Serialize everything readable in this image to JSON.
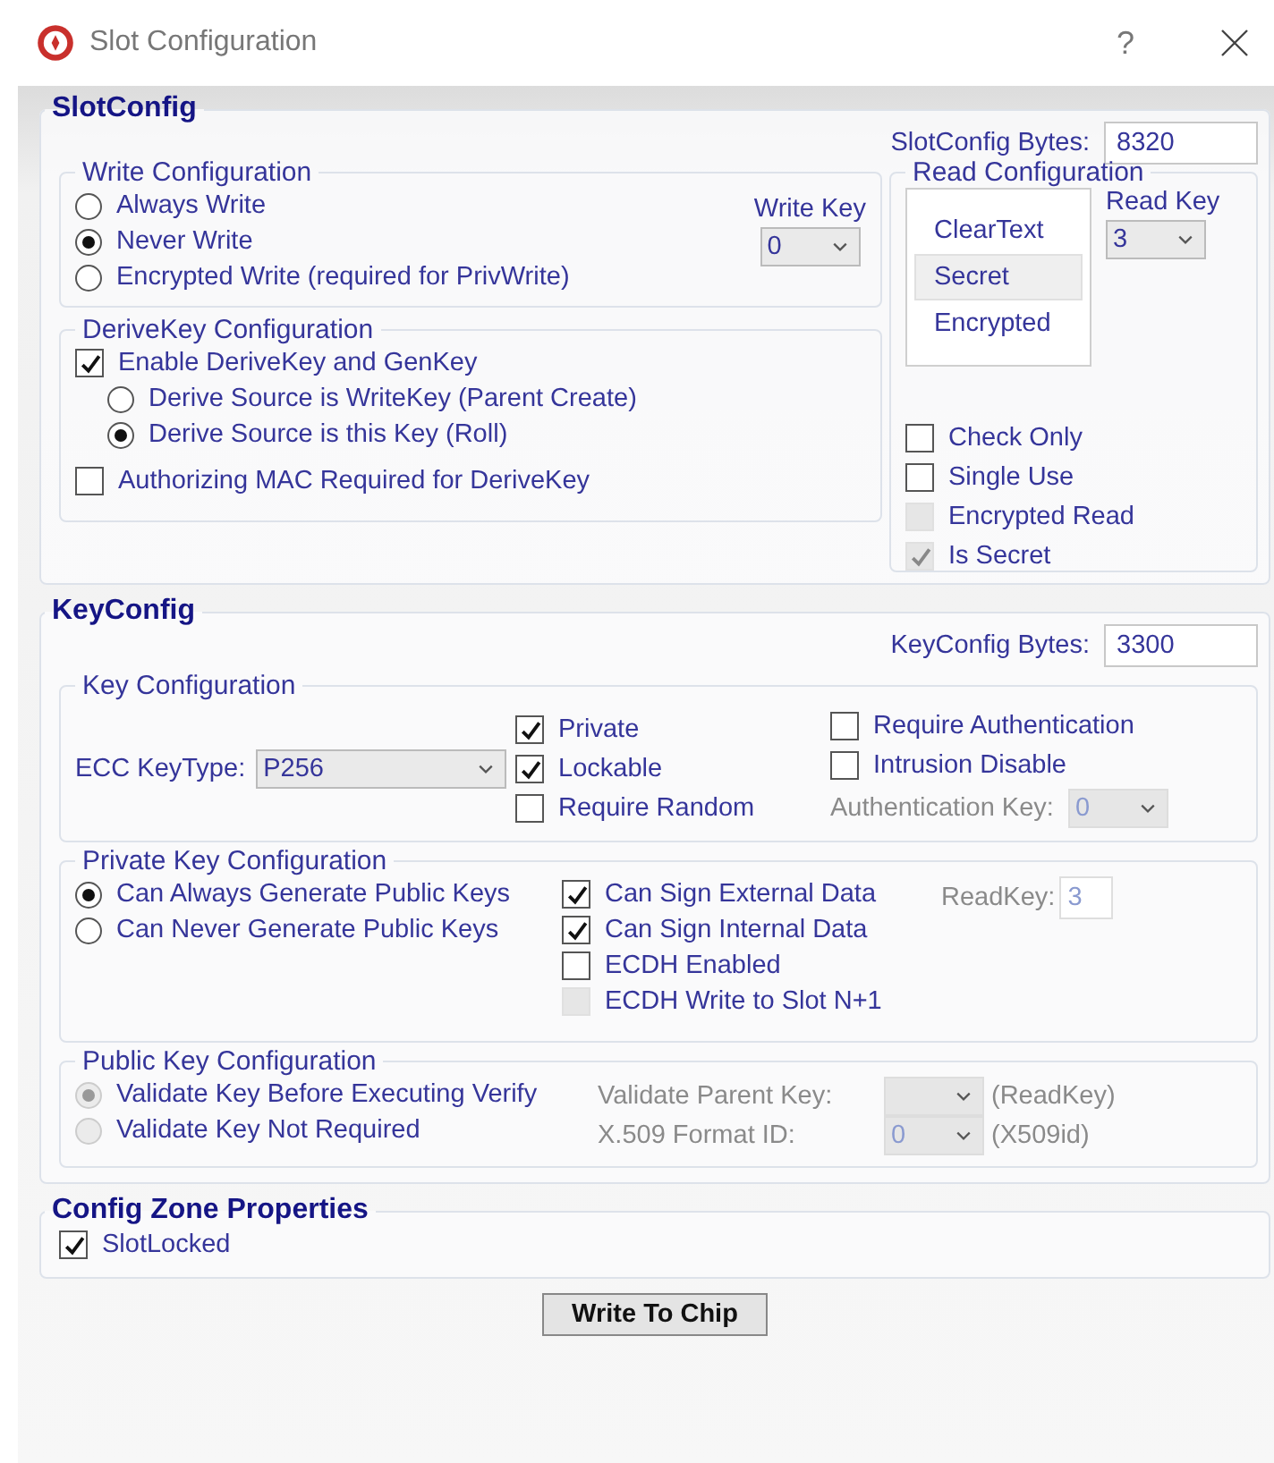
{
  "window": {
    "title": "Slot Configuration",
    "help": "?"
  },
  "slot_config": {
    "title": "SlotConfig",
    "bytes_label": "SlotConfig Bytes:",
    "bytes_value": "8320",
    "write_configuration": {
      "title": "Write Configuration",
      "options": [
        {
          "label": "Always Write",
          "selected": false
        },
        {
          "label": "Never Write",
          "selected": true
        },
        {
          "label": "Encrypted Write (required for PrivWrite)",
          "selected": false
        }
      ],
      "write_key": {
        "label": "Write Key",
        "value": "0"
      }
    },
    "derivekey_configuration": {
      "title": "DeriveKey Configuration",
      "enable": {
        "label": "Enable DeriveKey and GenKey",
        "checked": true
      },
      "sources": [
        {
          "label": "Derive Source is WriteKey (Parent Create)",
          "selected": false
        },
        {
          "label": "Derive Source is this Key (Roll)",
          "selected": true
        }
      ],
      "authorizing_mac": {
        "label": "Authorizing MAC Required for DeriveKey",
        "checked": false
      }
    },
    "read_configuration": {
      "title": "Read Configuration",
      "modes": [
        {
          "label": "ClearText",
          "selected": false
        },
        {
          "label": "Secret",
          "selected": true
        },
        {
          "label": "Encrypted",
          "selected": false
        }
      ],
      "read_key": {
        "label": "Read Key",
        "value": "3"
      },
      "options": [
        {
          "label": "Check Only",
          "checked": false,
          "disabled": false
        },
        {
          "label": "Single Use",
          "checked": false,
          "disabled": false
        },
        {
          "label": "Encrypted Read",
          "checked": false,
          "disabled": true
        },
        {
          "label": "Is Secret",
          "checked": true,
          "disabled": true
        }
      ]
    }
  },
  "key_config": {
    "title": "KeyConfig",
    "bytes_label": "KeyConfig Bytes:",
    "bytes_value": "3300",
    "key_configuration": {
      "title": "Key Configuration",
      "key_type_label": "ECC KeyType:",
      "key_type_value": "P256",
      "flags": [
        {
          "label": "Private",
          "checked": true,
          "disabled": false
        },
        {
          "label": "Lockable",
          "checked": true,
          "disabled": false
        },
        {
          "label": "Require Random",
          "checked": false,
          "disabled": false
        }
      ],
      "flags_2": [
        {
          "label": "Require Authentication",
          "checked": false,
          "disabled": false
        },
        {
          "label": "Intrusion Disable",
          "checked": false,
          "disabled": false
        }
      ],
      "auth_key": {
        "label": "Authentication Key:",
        "value": "0",
        "disabled": true
      }
    },
    "private_key_configuration": {
      "title": "Private Key Configuration",
      "options": [
        {
          "label": "Can Always Generate Public Keys",
          "selected": true
        },
        {
          "label": "Can Never Generate Public Keys",
          "selected": false
        }
      ],
      "flags": [
        {
          "label": "Can Sign External Data",
          "checked": true,
          "disabled": false
        },
        {
          "label": "Can Sign Internal Data",
          "checked": true,
          "disabled": false
        },
        {
          "label": "ECDH Enabled",
          "checked": false,
          "disabled": false
        },
        {
          "label": "ECDH Write to Slot N+1",
          "checked": false,
          "disabled": true
        }
      ],
      "read_key": {
        "label": "ReadKey:",
        "value": "3",
        "disabled": true
      }
    },
    "public_key_configuration": {
      "title": "Public Key Configuration",
      "options": [
        {
          "label": "Validate Key Before Executing Verify",
          "selected": true,
          "disabled": true
        },
        {
          "label": "Validate Key Not Required",
          "selected": false,
          "disabled": true
        }
      ],
      "fields": [
        {
          "label": "Validate Parent Key:",
          "suffix": "(ReadKey)",
          "disabled": true
        },
        {
          "label": "X.509 Format ID:",
          "value": "0",
          "suffix": "(X509id)",
          "disabled": true
        }
      ]
    }
  },
  "config_zone_properties": {
    "title": "Config Zone Properties",
    "slot_locked": {
      "label": "SlotLocked",
      "checked": true
    }
  },
  "write_button": "Write To Chip"
}
